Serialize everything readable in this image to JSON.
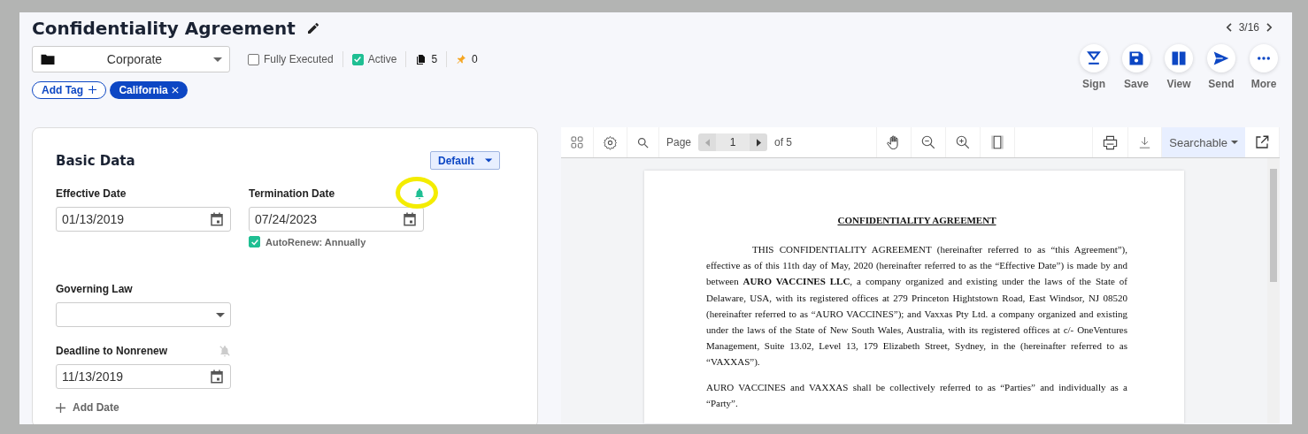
{
  "title": "Confidentiality Agreement",
  "pager": {
    "counter": "3/16"
  },
  "folder": {
    "name": "Corporate"
  },
  "flags": [
    {
      "label": "Fully Executed",
      "checked": false
    },
    {
      "label": "Active",
      "checked": true
    }
  ],
  "counts": [
    {
      "kind": "documents",
      "value": "5"
    },
    {
      "kind": "pins",
      "value": "0"
    }
  ],
  "tags": {
    "add_label": "Add Tag",
    "items": [
      {
        "label": "California"
      }
    ]
  },
  "actions": [
    {
      "kind": "sign",
      "label": "Sign"
    },
    {
      "kind": "save",
      "label": "Save"
    },
    {
      "kind": "view",
      "label": "View"
    },
    {
      "kind": "send",
      "label": "Send"
    },
    {
      "kind": "more",
      "label": "More"
    }
  ],
  "panel": {
    "title": "Basic Data",
    "view_select": "Default",
    "rows": [
      [
        {
          "kind": "date",
          "label": "Effective Date",
          "value": "01/13/2019"
        },
        {
          "kind": "date",
          "label": "Termination Date",
          "value": "07/24/2023",
          "alert": true,
          "highlighted": true,
          "autorenew": {
            "checked": true,
            "label": "AutoRenew: Annually"
          }
        }
      ],
      [
        {
          "kind": "select",
          "label": "Governing Law"
        }
      ],
      [
        {
          "kind": "date",
          "label": "Deadline to Nonrenew",
          "value": "11/13/2019",
          "alert": false
        }
      ]
    ],
    "add_label": "Add Date"
  },
  "viewer": {
    "page_label": "Page",
    "page_value": "1",
    "page_total": "of 5",
    "mode": "Searchable",
    "document": {
      "heading": "CONFIDENTIALITY AGREEMENT",
      "paragraphs": [
        "THIS CONFIDENTIALITY AGREEMENT (hereinafter referred to as “this Agreement”), effective as of this 11th day of May, 2020 (hereinafter referred to as the “Effective Date”) is made by and between **AURO VACCINES LLC**, a company organized and existing under the laws of the State of Delaware, USA, with its registered offices at 279 Princeton Hightstown Road, East Windsor, NJ 08520 (hereinafter referred to as “AURO VACCINES”); and Vaxxas Pty Ltd. a company organized and existing under the laws of the State of New South Wales, Australia, with its registered offices at c/- OneVentures Management, Suite 13.02, Level 13, 179 Elizabeth Street, Sydney, in the (hereinafter referred to as “VAXXAS”).",
        "AURO VACCINES and VAXXAS shall be collectively referred to as “Parties” and individually as a “Party”."
      ]
    }
  }
}
